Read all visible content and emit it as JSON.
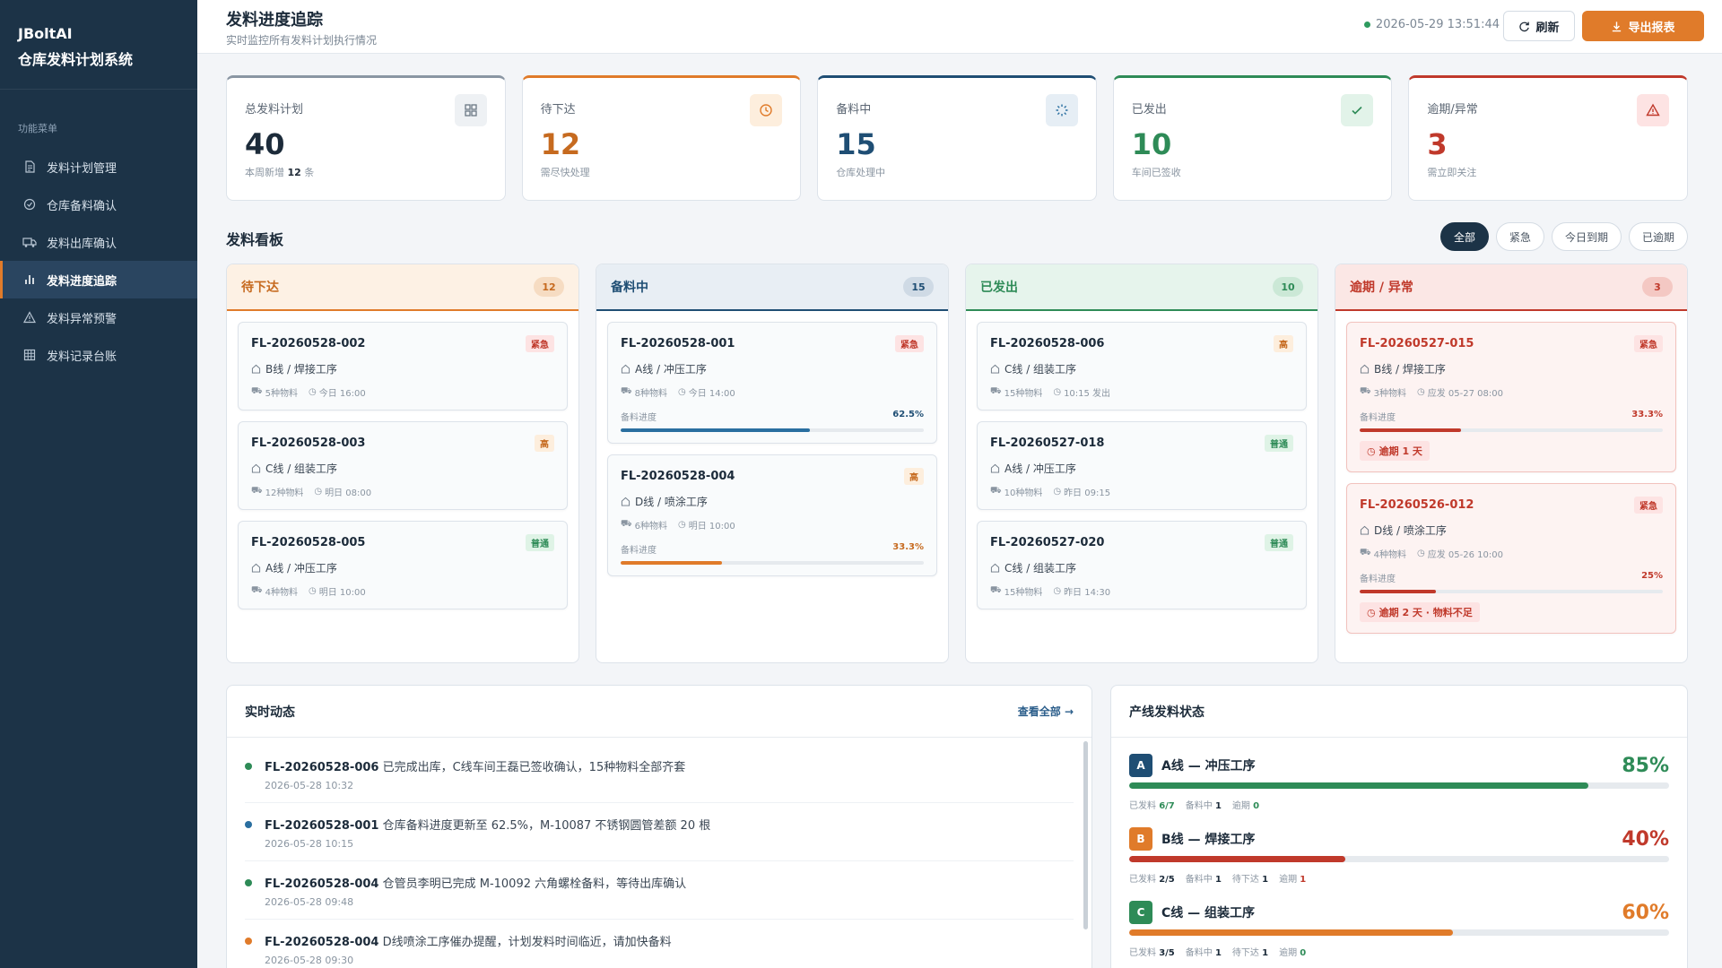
{
  "sidebar": {
    "brand_line1": "JBoltAI",
    "brand_line2": "仓库发料计划系统",
    "menu_title": "功能菜单",
    "items": [
      {
        "label": "发料计划管理",
        "icon": "document-icon"
      },
      {
        "label": "仓库备料确认",
        "icon": "check-circle-icon"
      },
      {
        "label": "发料出库确认",
        "icon": "truck-icon"
      },
      {
        "label": "发料进度追踪",
        "icon": "bar-chart-icon"
      },
      {
        "label": "发料异常预警",
        "icon": "warning-icon"
      },
      {
        "label": "发料记录台账",
        "icon": "grid-icon"
      }
    ]
  },
  "header": {
    "title": "发料进度追踪",
    "subtitle": "实时监控所有发料计划执行情况",
    "datetime": "2026-05-29 13:51:44",
    "refresh_label": "刷新",
    "export_label": "导出报表"
  },
  "stats": [
    {
      "label": "总发料计划",
      "value": "40",
      "note_prefix": "本周新增 ",
      "note_bold": "12",
      "note_suffix": " 条",
      "color": "#1c2b3a",
      "accent": "#8a96a3"
    },
    {
      "label": "待下达",
      "value": "12",
      "note": "需尽快处理",
      "color": "#c66a1f",
      "accent": "#e07b2a"
    },
    {
      "label": "备料中",
      "value": "15",
      "note": "仓库处理中",
      "color": "#1f4e74",
      "accent": "#1f4e74"
    },
    {
      "label": "已发出",
      "value": "10",
      "note": "车间已签收",
      "color": "#2e8b57",
      "accent": "#2e8b57"
    },
    {
      "label": "逾期/异常",
      "value": "3",
      "note": "需立即关注",
      "color": "#c0392b",
      "accent": "#c0392b"
    }
  ],
  "kanban": {
    "title": "发料看板",
    "filters": [
      "全部",
      "紧急",
      "今日到期",
      "已逾期"
    ],
    "columns": [
      {
        "title": "待下达",
        "count": "12",
        "cards": [
          {
            "id": "FL-20260528-002",
            "tag": "紧急",
            "line": "B线 / 焊接工序",
            "materials": "5种物料",
            "time": "今日 16:00"
          },
          {
            "id": "FL-20260528-003",
            "tag": "高",
            "line": "C线 / 组装工序",
            "materials": "12种物料",
            "time": "明日 08:00"
          },
          {
            "id": "FL-20260528-005",
            "tag": "普通",
            "line": "A线 / 冲压工序",
            "materials": "4种物料",
            "time": "明日 10:00"
          }
        ]
      },
      {
        "title": "备料中",
        "count": "15",
        "cards": [
          {
            "id": "FL-20260528-001",
            "tag": "紧急",
            "line": "A线 / 冲压工序",
            "materials": "8种物料",
            "time": "今日 14:00",
            "progress_label": "备料进度",
            "progress": "62.5%"
          },
          {
            "id": "FL-20260528-004",
            "tag": "高",
            "line": "D线 / 喷涂工序",
            "materials": "6种物料",
            "time": "明日 10:00",
            "progress_label": "备料进度",
            "progress": "33.3%"
          }
        ]
      },
      {
        "title": "已发出",
        "count": "10",
        "cards": [
          {
            "id": "FL-20260528-006",
            "tag": "高",
            "line": "C线 / 组装工序",
            "materials": "15种物料",
            "time": "10:15 发出"
          },
          {
            "id": "FL-20260527-018",
            "tag": "普通",
            "line": "A线 / 冲压工序",
            "materials": "10种物料",
            "time": "昨日 09:15"
          },
          {
            "id": "FL-20260527-020",
            "tag": "普通",
            "line": "C线 / 组装工序",
            "materials": "15种物料",
            "time": "昨日 14:30"
          }
        ]
      },
      {
        "title": "逾期 / 异常",
        "count": "3",
        "cards": [
          {
            "id": "FL-20260527-015",
            "tag": "紧急",
            "line": "B线 / 焊接工序",
            "materials": "3种物料",
            "time": "应发 05-27 08:00",
            "progress_label": "备料进度",
            "progress": "33.3%",
            "overdue": "逾期 1 天"
          },
          {
            "id": "FL-20260526-012",
            "tag": "紧急",
            "line": "D线 / 喷涂工序",
            "materials": "4种物料",
            "time": "应发 05-26 10:00",
            "progress_label": "备料进度",
            "progress": "25%",
            "overdue": "逾期 2 天 · 物料不足"
          }
        ]
      }
    ]
  },
  "activity": {
    "title": "实时动态",
    "more": "查看全部 →",
    "items": [
      {
        "id": "FL-20260528-006",
        "text": " 已完成出库，C线车间王磊已签收确认，15种物料全部齐套",
        "time": "2026-05-28 10:32",
        "color": "#2e8b57"
      },
      {
        "id": "FL-20260528-001",
        "text": " 仓库备料进度更新至 62.5%，M-10087 不锈钢圆管差额 20 根",
        "time": "2026-05-28 10:15",
        "color": "#2a6fa0"
      },
      {
        "id": "FL-20260528-004",
        "text": " 仓管员李明已完成 M-10092 六角螺栓备料，等待出库确认",
        "time": "2026-05-28 09:48",
        "color": "#2e8b57"
      },
      {
        "id": "FL-20260528-004",
        "text": " D线喷涂工序催办提醒，计划发料时间临近，请加快备料",
        "time": "2026-05-28 09:30",
        "color": "#e07b2a"
      }
    ]
  },
  "lines": {
    "title": "产线发料状态",
    "items": [
      {
        "badge": "A",
        "name": "A线 — 冲压工序",
        "pct": "85%",
        "pct_value": 85,
        "color": "#2e8b57",
        "badge_color": "#1f4e74",
        "stats": [
          {
            "k": "已发料 ",
            "v": "6/7",
            "c": "g"
          },
          {
            "k": "备料中 ",
            "v": "1",
            "c": ""
          },
          {
            "k": "逾期 ",
            "v": "0",
            "c": "g"
          }
        ]
      },
      {
        "badge": "B",
        "name": "B线 — 焊接工序",
        "pct": "40%",
        "pct_value": 40,
        "color": "#c0392b",
        "badge_color": "#e07b2a",
        "stats": [
          {
            "k": "已发料 ",
            "v": "2/5",
            "c": ""
          },
          {
            "k": "备料中 ",
            "v": "1",
            "c": ""
          },
          {
            "k": "待下达 ",
            "v": "1",
            "c": ""
          },
          {
            "k": "逾期 ",
            "v": "1",
            "c": "r"
          }
        ]
      },
      {
        "badge": "C",
        "name": "C线 — 组装工序",
        "pct": "60%",
        "pct_value": 60,
        "color": "#e07b2a",
        "badge_color": "#2e8b57",
        "stats": [
          {
            "k": "已发料 ",
            "v": "3/5",
            "c": ""
          },
          {
            "k": "备料中 ",
            "v": "1",
            "c": ""
          },
          {
            "k": "待下达 ",
            "v": "1",
            "c": ""
          },
          {
            "k": "逾期 ",
            "v": "0",
            "c": "g"
          }
        ]
      }
    ]
  }
}
